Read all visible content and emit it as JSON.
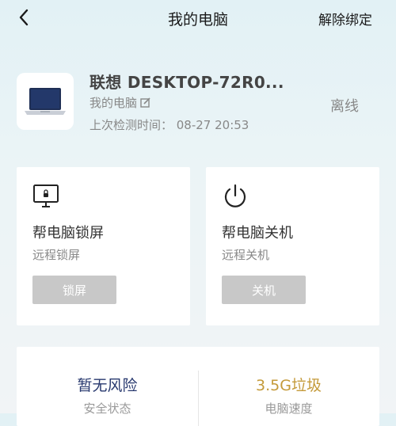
{
  "header": {
    "title": "我的电脑",
    "unbind_label": "解除绑定",
    "back_icon": "chevron-left-icon"
  },
  "device": {
    "name": "联想 DESKTOP-72R0...",
    "subtitle": "我的电脑",
    "edit_icon": "edit-icon",
    "last_check": "上次检测时间： 08-27 20:53",
    "status": "离线",
    "thumbnail_icon": "laptop-icon"
  },
  "actions": [
    {
      "icon": "monitor-lock-icon",
      "title": "帮电脑锁屏",
      "desc": "远程锁屏",
      "button": "锁屏"
    },
    {
      "icon": "power-icon",
      "title": "帮电脑关机",
      "desc": "远程关机",
      "button": "关机"
    }
  ],
  "stats": [
    {
      "value": "暂无风险",
      "label": "安全状态",
      "color": "#27386e"
    },
    {
      "value": "3.5G垃圾",
      "label": "电脑速度",
      "color": "#c49a3a"
    }
  ]
}
